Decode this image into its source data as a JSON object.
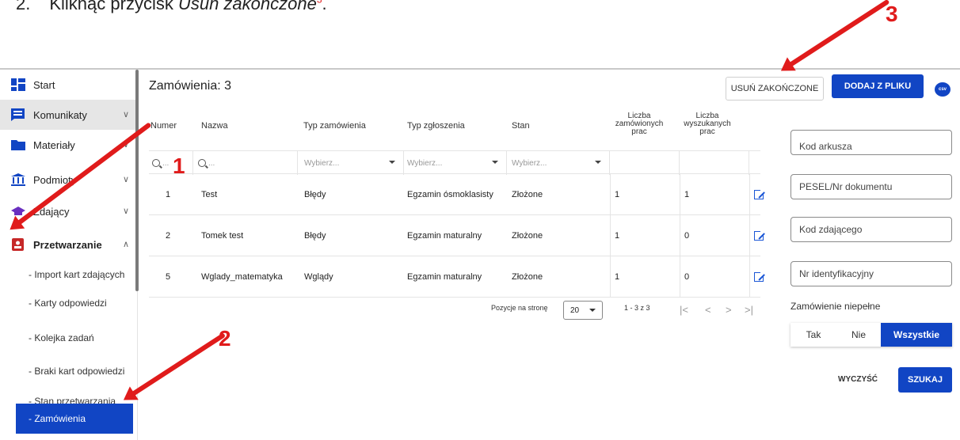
{
  "doc_header": {
    "number": "2.",
    "prefix": "Kliknąć przycisk ",
    "italic": "Usuń zakończone",
    "marker": "3",
    "suffix": "."
  },
  "sidebar": {
    "items": [
      {
        "label": "Start",
        "icon": "dashboard-icon"
      },
      {
        "label": "Komunikaty",
        "icon": "message-icon"
      },
      {
        "label": "Materiały",
        "icon": "folder-icon"
      },
      {
        "label": "Podmioty",
        "icon": "institution-icon"
      },
      {
        "label": "Zdający",
        "icon": "graduation-cap-icon"
      },
      {
        "label": "Przetwarzanie",
        "icon": "badge-icon"
      }
    ],
    "subitems": [
      "- Import kart zdających",
      "- Karty odpowiedzi",
      "- Kolejka zadań",
      "- Braki kart odpowiedzi",
      "- Stan przetwarzania",
      "- Zamówienia"
    ]
  },
  "main": {
    "title": "Zamówienia: 3",
    "delete_finished": "USUŃ ZAKOŃCZONE",
    "add_from_file": "DODAJ Z PLIKU",
    "csv_label": "csv"
  },
  "table": {
    "headers": {
      "numer": "Numer",
      "nazwa": "Nazwa",
      "typ_zamowienia": "Typ zamówienia",
      "typ_zgloszenia": "Typ zgłoszenia",
      "stan": "Stan",
      "liczba_zam": [
        "Liczba",
        "zamówionych",
        "prac"
      ],
      "liczba_wysz": [
        "Liczba",
        "wyszukanych",
        "prac"
      ]
    },
    "filter_placeholders": {
      "search": "...",
      "select": "Wybierz..."
    },
    "rows": [
      {
        "numer": "1",
        "nazwa": "Test",
        "typ_zamowienia": "Błędy",
        "typ_zgloszenia": "Egzamin ósmoklasisty",
        "stan": "Złożone",
        "zamowionych": "1",
        "wyszukanych": "1"
      },
      {
        "numer": "2",
        "nazwa": "Tomek test",
        "typ_zamowienia": "Błędy",
        "typ_zgloszenia": "Egzamin maturalny",
        "stan": "Złożone",
        "zamowionych": "1",
        "wyszukanych": "0"
      },
      {
        "numer": "5",
        "nazwa": "Wglady_matematyka",
        "typ_zamowienia": "Wglądy",
        "typ_zgloszenia": "Egzamin maturalny",
        "stan": "Złożone",
        "zamowionych": "1",
        "wyszukanych": "0"
      }
    ],
    "pager": {
      "label": "Pozycje na stronę",
      "per_page": "20",
      "range": "1 - 3 z 3",
      "first": "|<",
      "prev": "<",
      "next": ">",
      "last": ">|"
    }
  },
  "filters": {
    "kod_arkusza": "Kod arkusza",
    "pesel": "PESEL/Nr dokumentu",
    "kod_zdajacego": "Kod zdającego",
    "nr_ident": "Nr identyfikacyjny",
    "niepelne_label": "Zamówienie niepełne",
    "options": [
      "Tak",
      "Nie",
      "Wszystkie"
    ],
    "selected": "Wszystkie",
    "clear": "WYCZYŚĆ",
    "search": "SZUKAJ"
  },
  "annotations": {
    "a1": "1",
    "a2": "2",
    "a3": "3",
    "color": "#e01b1b"
  },
  "colors": {
    "primary": "#1145c4",
    "link_icon": "#1a56d6"
  }
}
